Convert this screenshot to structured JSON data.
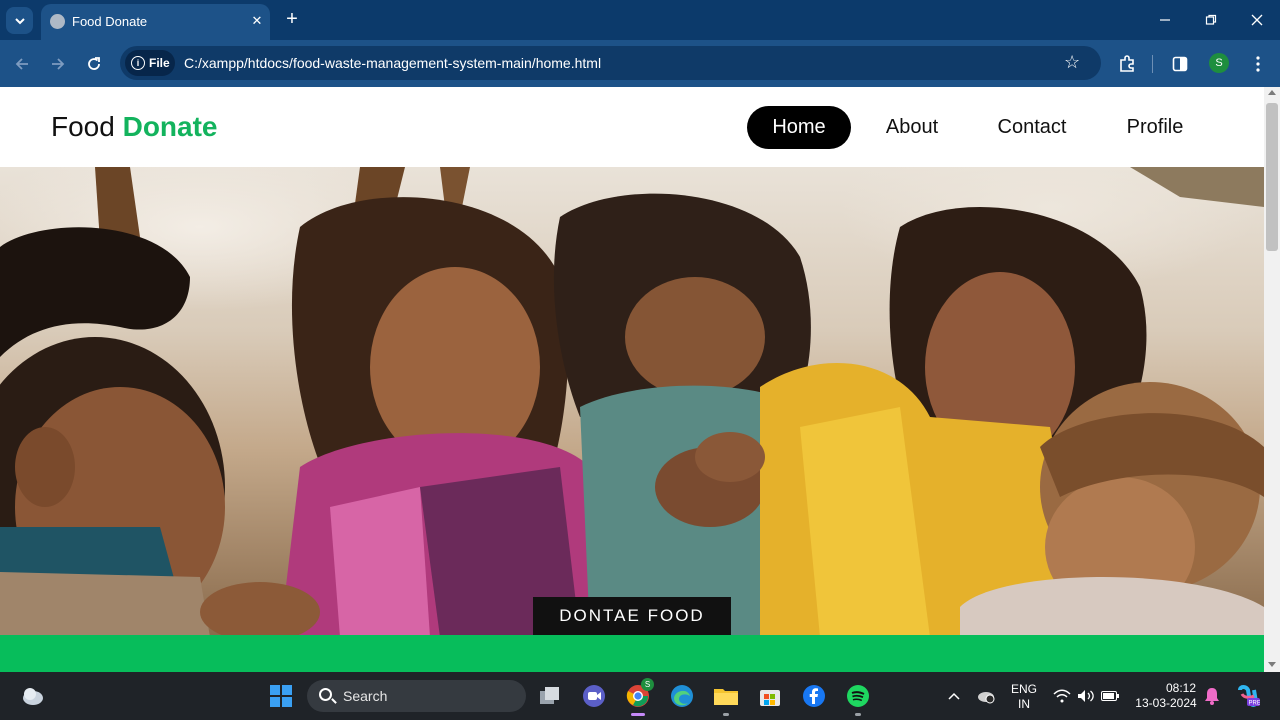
{
  "browser": {
    "tab": {
      "title": "Food Donate"
    },
    "address": {
      "chip": "File",
      "url": "C:/xampp/htdocs/food-waste-management-system-main/home.html"
    },
    "profile_initial": "S"
  },
  "site": {
    "logo": {
      "first": "Food",
      "accent": "Donate",
      "accent_color": "#13b35d"
    },
    "nav": [
      {
        "label": "Home",
        "active": true
      },
      {
        "label": "About",
        "active": false
      },
      {
        "label": "Contact",
        "active": false
      },
      {
        "label": "Profile",
        "active": false
      }
    ],
    "hero_button": "DONTAE FOOD",
    "band_color": "#07bd5b"
  },
  "taskbar": {
    "search_placeholder": "Search",
    "chrome_badge": "S",
    "language": {
      "line1": "ENG",
      "line2": "IN"
    },
    "time": "08:12",
    "date": "13-03-2024"
  }
}
